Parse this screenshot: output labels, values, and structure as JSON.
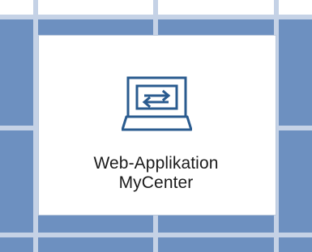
{
  "tile": {
    "label_line1": "Web-Applikation",
    "label_line2": "MyCenter",
    "icon": "laptop-sync-icon"
  },
  "colors": {
    "background_blue": "#6d90c0",
    "grid_light": "#c5d2e6",
    "tile_background": "#ffffff",
    "icon_blue": "#2a5b8f",
    "text": "#1b1b1b"
  }
}
